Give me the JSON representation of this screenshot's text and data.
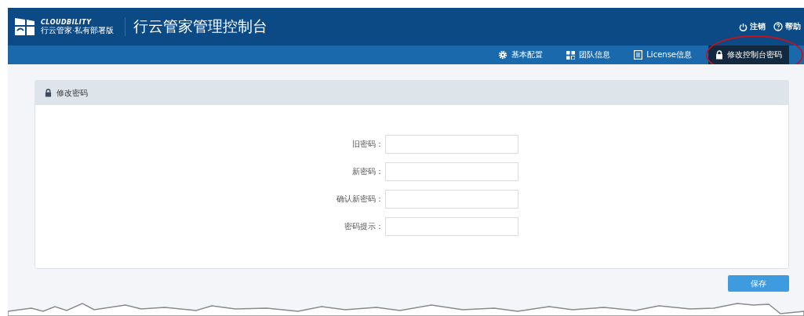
{
  "header": {
    "brand": "CLOUDBILITY",
    "brand_sub": "行云管家·私有部署版",
    "title": "行云管家管理控制台",
    "links": [
      {
        "label": "注销",
        "kind": "power"
      },
      {
        "label": "帮助",
        "kind": "help"
      }
    ]
  },
  "nav": [
    {
      "label": "基本配置",
      "kind": "gear",
      "selected": false
    },
    {
      "label": "团队信息",
      "kind": "grid",
      "selected": false
    },
    {
      "label": "License信息",
      "kind": "doc",
      "selected": false
    },
    {
      "label": "修改控制台密码",
      "kind": "lock",
      "selected": true
    }
  ],
  "panel": {
    "title": "修改密码",
    "fields": [
      {
        "label": "旧密码："
      },
      {
        "label": "新密码："
      },
      {
        "label": "确认新密码："
      },
      {
        "label": "密码提示："
      }
    ]
  },
  "save_button": "保存"
}
